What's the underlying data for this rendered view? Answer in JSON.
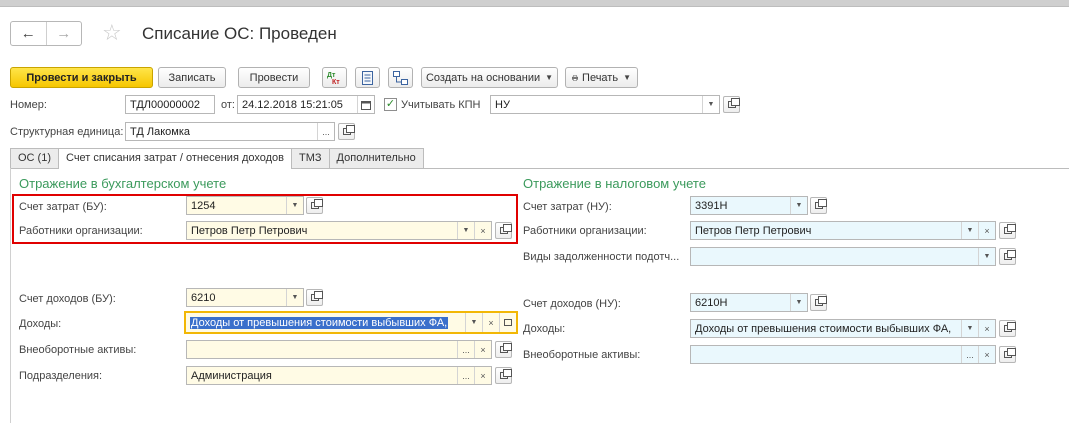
{
  "window": {
    "title": "Списание ОС: Проведен"
  },
  "toolbar": {
    "post_close": "Провести и закрыть",
    "save": "Записать",
    "post": "Провести",
    "create_based": "Создать на основании",
    "print": "Печать",
    "dt_kt": "Дт Кт"
  },
  "header": {
    "number_label": "Номер:",
    "number_value": "ТДЛ00000002",
    "date_label": "от:",
    "date_value": "24.12.2018 15:21:05",
    "kpn_label": "Учитывать КПН",
    "kpn_checked": true,
    "kpn_value": "НУ",
    "unit_label": "Структурная единица:",
    "unit_value": "ТД Лакомка"
  },
  "tabs": [
    {
      "label": "ОС (1)",
      "active": false
    },
    {
      "label": "Счет списания затрат / отнесения доходов",
      "active": true
    },
    {
      "label": "ТМЗ",
      "active": false
    },
    {
      "label": "Дополнительно",
      "active": false
    }
  ],
  "bu": {
    "section_title": "Отражение в бухгалтерском учете",
    "cost_account_label": "Счет затрат (БУ):",
    "cost_account_value": "1254",
    "employees_label": "Работники организации:",
    "employees_value": "Петров Петр Петрович",
    "income_account_label": "Счет доходов (БУ):",
    "income_account_value": "6210",
    "income_label": "Доходы:",
    "income_value": "Доходы от превышения стоимости выбывших ФА,",
    "noncurrent_label": "Внеоборотные активы:",
    "noncurrent_value": "",
    "division_label": "Подразделения:",
    "division_value": "Администрация"
  },
  "nu": {
    "section_title": "Отражение в налоговом учете",
    "cost_account_label": "Счет затрат (НУ):",
    "cost_account_value": "3391Н",
    "employees_label": "Работники организации:",
    "employees_value": "Петров Петр Петрович",
    "debt_types_label": "Виды задолженности подотч...",
    "debt_types_value": "",
    "income_account_label": "Счет доходов (НУ):",
    "income_account_value": "6210Н",
    "income_label": "Доходы:",
    "income_value": "Доходы от превышения стоимости выбывших ФА,",
    "noncurrent_label": "Внеоборотные активы:",
    "noncurrent_value": ""
  },
  "colors": {
    "primary_button": "#f6c600",
    "section_title": "#3b9a5c",
    "highlight_box": "#e00000",
    "focus_border": "#f2b705",
    "required_field": "#fffbe5",
    "tax_field": "#eaf8fd"
  }
}
